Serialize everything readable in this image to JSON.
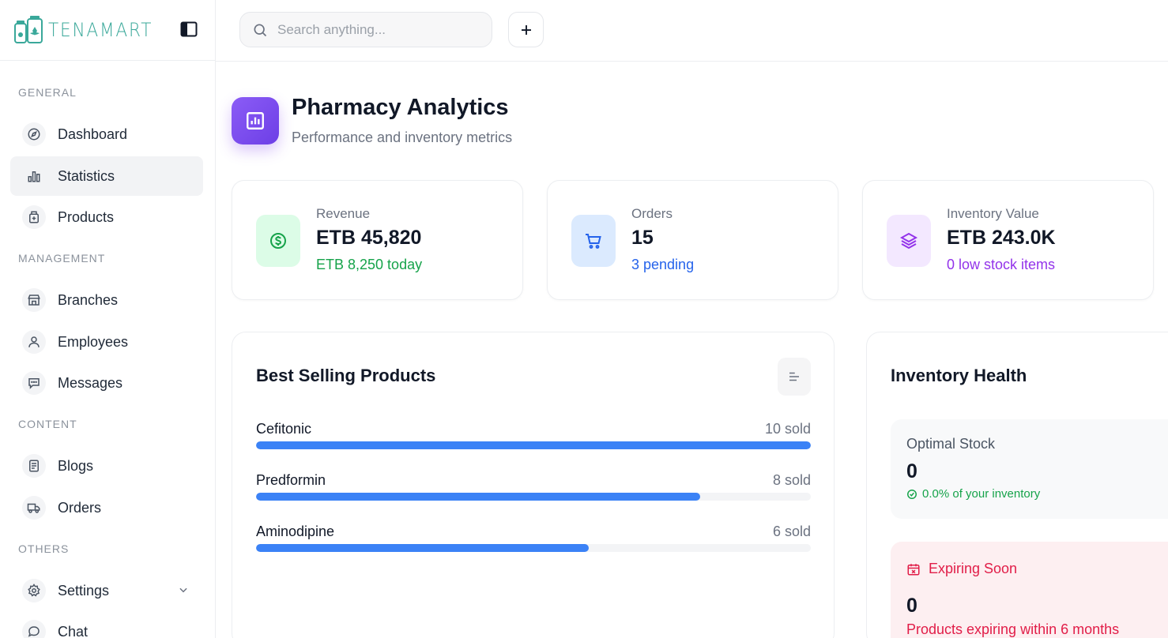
{
  "app": {
    "brand_name": "TENAMART",
    "accent": "#3aa89a"
  },
  "search": {
    "placeholder": "Search anything..."
  },
  "sidebar": {
    "sections": [
      {
        "label": "GENERAL",
        "items": [
          {
            "label": "Dashboard",
            "icon": "compass-icon"
          },
          {
            "label": "Statistics",
            "icon": "bar-chart-icon",
            "active": true
          },
          {
            "label": "Products",
            "icon": "medicine-box-icon"
          }
        ]
      },
      {
        "label": "MANAGEMENT",
        "items": [
          {
            "label": "Branches",
            "icon": "store-icon"
          },
          {
            "label": "Employees",
            "icon": "user-icon"
          },
          {
            "label": "Messages",
            "icon": "message-icon"
          }
        ]
      },
      {
        "label": "CONTENT",
        "items": [
          {
            "label": "Blogs",
            "icon": "document-icon"
          },
          {
            "label": "Orders",
            "icon": "truck-icon"
          }
        ]
      },
      {
        "label": "OTHERS",
        "items": [
          {
            "label": "Settings",
            "icon": "gear-icon",
            "has_submenu": true
          },
          {
            "label": "Chat",
            "icon": "chat-icon"
          }
        ]
      }
    ]
  },
  "page": {
    "title": "Pharmacy Analytics",
    "subtitle": "Performance and inventory metrics"
  },
  "stats": [
    {
      "label": "Revenue",
      "value": "ETB 45,820",
      "sub": "ETB 8,250 today",
      "icon": "dollar-icon",
      "color": "#16a34a",
      "bg": "#dcfce7"
    },
    {
      "label": "Orders",
      "value": "15",
      "sub": "3 pending",
      "icon": "cart-icon",
      "color": "#2563eb",
      "bg": "#dbeafe"
    },
    {
      "label": "Inventory Value",
      "value": "ETB 243.0K",
      "sub": "0 low stock items",
      "icon": "layers-icon",
      "color": "#9333ea",
      "bg": "#f3e8ff"
    }
  ],
  "best_selling": {
    "title": "Best Selling Products",
    "bar_color": "#3b82f6",
    "products": [
      {
        "name": "Cefitonic",
        "sold": "10 sold",
        "fraction": 1.0
      },
      {
        "name": "Predformin",
        "sold": "8 sold",
        "fraction": 0.8
      },
      {
        "name": "Aminodipine",
        "sold": "6 sold",
        "fraction": 0.6
      }
    ]
  },
  "inventory_health": {
    "title": "Inventory Health",
    "optimal": {
      "label": "Optimal Stock",
      "value": "0",
      "note": "0.0% of your inventory"
    },
    "expiring": {
      "label": "Expiring Soon",
      "value": "0",
      "note": "Products expiring within 6 months"
    }
  }
}
